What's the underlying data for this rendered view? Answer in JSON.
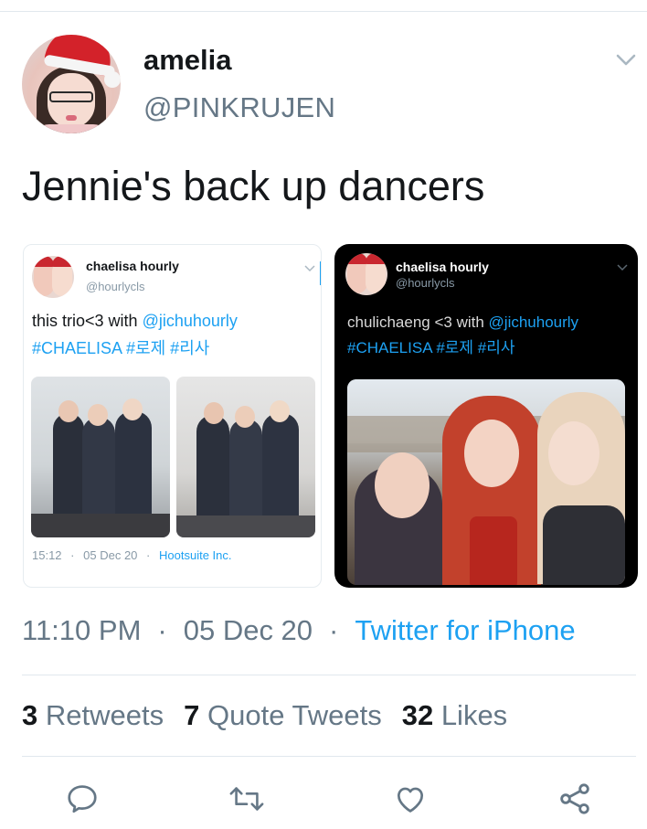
{
  "tweet": {
    "author_name": "amelia",
    "author_handle": "@PINKRUJEN",
    "text": "Jennie's back up dancers",
    "time": "11:10 PM",
    "date": "05 Dec 20",
    "source": "Twitter for iPhone",
    "separator": "·"
  },
  "quoted_left": {
    "name": "chaelisa hourly",
    "handle": "@hourlycls",
    "text_plain": "this trio<3 with ",
    "text_mention": "@jichuhourly",
    "hashtags": "#CHAELISA #로제 #리사",
    "time": "15:12",
    "date": "05 Dec 20",
    "source": "Hootsuite Inc.",
    "separator": "·"
  },
  "quoted_right": {
    "name": "chaelisa hourly",
    "handle": "@hourlycls",
    "text_plain": "chulichaeng <3 with ",
    "text_mention": "@jichuhourly",
    "hashtags": "#CHAELISA #로제 #리사"
  },
  "stats": {
    "retweets_count": "3",
    "retweets_label": "Retweets",
    "quotes_count": "7",
    "quotes_label": "Quote Tweets",
    "likes_count": "32",
    "likes_label": "Likes"
  },
  "icons": {
    "reply": "reply-icon",
    "retweet": "retweet-icon",
    "like": "heart-icon",
    "share": "share-icon",
    "more": "chevron-down-icon"
  },
  "colors": {
    "link": "#1da1f2",
    "secondary_text": "#657786",
    "primary_text": "#14171a",
    "divider": "#e1e8ed"
  }
}
